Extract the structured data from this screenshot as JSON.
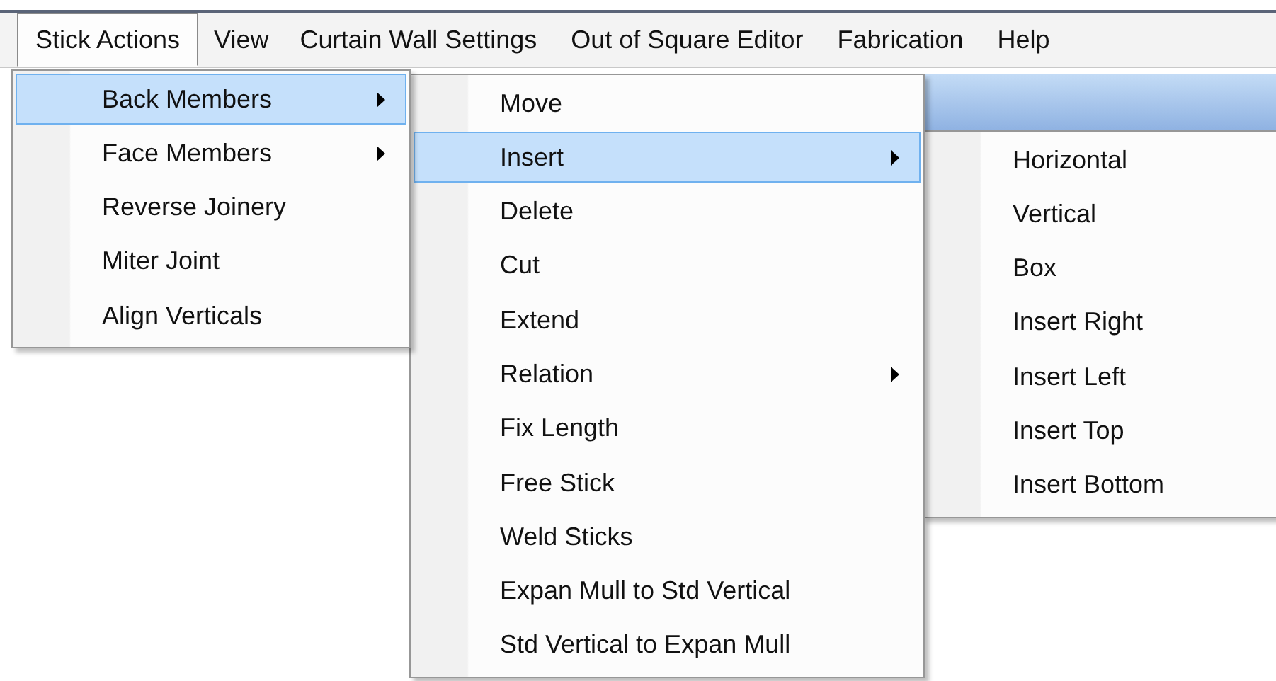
{
  "menubar": [
    {
      "label": "Stick Actions",
      "selected": true
    },
    {
      "label": "View",
      "selected": false
    },
    {
      "label": "Curtain Wall Settings",
      "selected": false
    },
    {
      "label": "Out of Square Editor",
      "selected": false
    },
    {
      "label": "Fabrication",
      "selected": false
    },
    {
      "label": "Help",
      "selected": false
    }
  ],
  "menus": [
    {
      "items": [
        {
          "label": "Back Members",
          "submenu": true,
          "selected": true
        },
        {
          "label": "Face Members",
          "submenu": true,
          "selected": false
        },
        {
          "label": "Reverse Joinery",
          "submenu": false,
          "selected": false
        },
        {
          "label": "Miter Joint",
          "submenu": false,
          "selected": false
        },
        {
          "label": "Align Verticals",
          "submenu": false,
          "selected": false
        }
      ]
    },
    {
      "items": [
        {
          "label": "Move",
          "submenu": false,
          "selected": false
        },
        {
          "label": "Insert",
          "submenu": true,
          "selected": true
        },
        {
          "label": "Delete",
          "submenu": false,
          "selected": false
        },
        {
          "label": "Cut",
          "submenu": false,
          "selected": false
        },
        {
          "label": "Extend",
          "submenu": false,
          "selected": false
        },
        {
          "label": "Relation",
          "submenu": true,
          "selected": false
        },
        {
          "label": "Fix Length",
          "submenu": false,
          "selected": false
        },
        {
          "label": "Free Stick",
          "submenu": false,
          "selected": false
        },
        {
          "label": "Weld Sticks",
          "submenu": false,
          "selected": false
        },
        {
          "label": "Expan Mull to Std Vertical",
          "submenu": false,
          "selected": false
        },
        {
          "label": "Std Vertical to Expan Mull",
          "submenu": false,
          "selected": false
        }
      ]
    },
    {
      "items": [
        {
          "label": "Horizontal",
          "submenu": false,
          "selected": false
        },
        {
          "label": "Vertical",
          "submenu": false,
          "selected": false
        },
        {
          "label": "Box",
          "submenu": false,
          "selected": false
        },
        {
          "label": "Insert Right",
          "submenu": false,
          "selected": false
        },
        {
          "label": "Insert Left",
          "submenu": false,
          "selected": false
        },
        {
          "label": "Insert Top",
          "submenu": false,
          "selected": false
        },
        {
          "label": "Insert Bottom",
          "submenu": false,
          "selected": false
        }
      ]
    }
  ]
}
